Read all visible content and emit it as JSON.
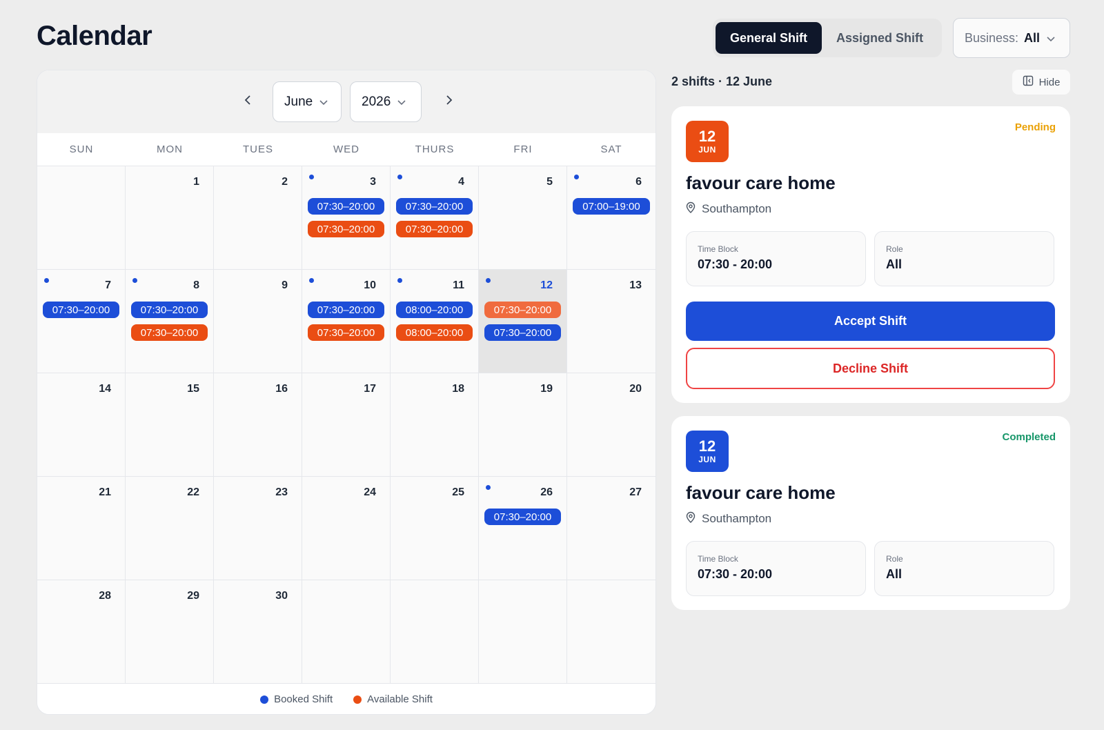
{
  "header": {
    "title": "Calendar"
  },
  "tabs": [
    {
      "label": "General Shift",
      "active": true
    },
    {
      "label": "Assigned Shift",
      "active": false
    }
  ],
  "business_filter": {
    "label": "Business:",
    "value": "All"
  },
  "calendar": {
    "month": "June",
    "year": "2026",
    "weekdays": [
      "SUN",
      "MON",
      "TUES",
      "WED",
      "THURS",
      "FRI",
      "SAT"
    ],
    "cells": [
      {
        "day": "",
        "dot": false,
        "selected": false,
        "shifts": []
      },
      {
        "day": "1",
        "dot": false,
        "selected": false,
        "shifts": []
      },
      {
        "day": "2",
        "dot": false,
        "selected": false,
        "shifts": []
      },
      {
        "day": "3",
        "dot": true,
        "selected": false,
        "shifts": [
          {
            "time": "07:30–20:00",
            "kind": "booked"
          },
          {
            "time": "07:30–20:00",
            "kind": "available"
          }
        ]
      },
      {
        "day": "4",
        "dot": true,
        "selected": false,
        "shifts": [
          {
            "time": "07:30–20:00",
            "kind": "booked"
          },
          {
            "time": "07:30–20:00",
            "kind": "available"
          }
        ]
      },
      {
        "day": "5",
        "dot": false,
        "selected": false,
        "shifts": []
      },
      {
        "day": "6",
        "dot": true,
        "selected": false,
        "shifts": [
          {
            "time": "07:00–19:00",
            "kind": "booked"
          }
        ]
      },
      {
        "day": "7",
        "dot": true,
        "selected": false,
        "shifts": [
          {
            "time": "07:30–20:00",
            "kind": "booked"
          }
        ]
      },
      {
        "day": "8",
        "dot": true,
        "selected": false,
        "shifts": [
          {
            "time": "07:30–20:00",
            "kind": "booked"
          },
          {
            "time": "07:30–20:00",
            "kind": "available"
          }
        ]
      },
      {
        "day": "9",
        "dot": false,
        "selected": false,
        "shifts": []
      },
      {
        "day": "10",
        "dot": true,
        "selected": false,
        "shifts": [
          {
            "time": "07:30–20:00",
            "kind": "booked"
          },
          {
            "time": "07:30–20:00",
            "kind": "available"
          }
        ]
      },
      {
        "day": "11",
        "dot": true,
        "selected": false,
        "shifts": [
          {
            "time": "08:00–20:00",
            "kind": "booked"
          },
          {
            "time": "08:00–20:00",
            "kind": "available"
          }
        ]
      },
      {
        "day": "12",
        "dot": true,
        "selected": true,
        "shifts": [
          {
            "time": "07:30–20:00",
            "kind": "available-light"
          },
          {
            "time": "07:30–20:00",
            "kind": "booked"
          }
        ]
      },
      {
        "day": "13",
        "dot": false,
        "selected": false,
        "shifts": []
      },
      {
        "day": "14",
        "dot": false,
        "selected": false,
        "shifts": []
      },
      {
        "day": "15",
        "dot": false,
        "selected": false,
        "shifts": []
      },
      {
        "day": "16",
        "dot": false,
        "selected": false,
        "shifts": []
      },
      {
        "day": "17",
        "dot": false,
        "selected": false,
        "shifts": []
      },
      {
        "day": "18",
        "dot": false,
        "selected": false,
        "shifts": []
      },
      {
        "day": "19",
        "dot": false,
        "selected": false,
        "shifts": []
      },
      {
        "day": "20",
        "dot": false,
        "selected": false,
        "shifts": []
      },
      {
        "day": "21",
        "dot": false,
        "selected": false,
        "shifts": []
      },
      {
        "day": "22",
        "dot": false,
        "selected": false,
        "shifts": []
      },
      {
        "day": "23",
        "dot": false,
        "selected": false,
        "shifts": []
      },
      {
        "day": "24",
        "dot": false,
        "selected": false,
        "shifts": []
      },
      {
        "day": "25",
        "dot": false,
        "selected": false,
        "shifts": []
      },
      {
        "day": "26",
        "dot": true,
        "selected": false,
        "shifts": [
          {
            "time": "07:30–20:00",
            "kind": "booked"
          }
        ]
      },
      {
        "day": "27",
        "dot": false,
        "selected": false,
        "shifts": []
      },
      {
        "day": "28",
        "dot": false,
        "selected": false,
        "shifts": []
      },
      {
        "day": "29",
        "dot": false,
        "selected": false,
        "shifts": []
      },
      {
        "day": "30",
        "dot": false,
        "selected": false,
        "shifts": []
      },
      {
        "day": "",
        "dot": false,
        "selected": false,
        "shifts": []
      },
      {
        "day": "",
        "dot": false,
        "selected": false,
        "shifts": []
      },
      {
        "day": "",
        "dot": false,
        "selected": false,
        "shifts": []
      },
      {
        "day": "",
        "dot": false,
        "selected": false,
        "shifts": []
      }
    ],
    "legend": [
      {
        "label": "Booked Shift",
        "color": "#1d4ed8"
      },
      {
        "label": "Available Shift",
        "color": "#ea4d13"
      }
    ]
  },
  "panel": {
    "summary": "2 shifts · 12 June",
    "hide_label": "Hide",
    "shifts": [
      {
        "day": "12",
        "month": "JUN",
        "status": "Pending",
        "place": "favour care home",
        "location": "Southampton",
        "time_block_label": "Time Block",
        "time_block": "07:30 - 20:00",
        "role_label": "Role",
        "role": "All",
        "accept_label": "Accept Shift",
        "decline_label": "Decline Shift"
      },
      {
        "day": "12",
        "month": "JUN",
        "status": "Completed",
        "place": "favour care home",
        "location": "Southampton",
        "time_block_label": "Time Block",
        "time_block": "07:30 - 20:00",
        "role_label": "Role",
        "role": "All"
      }
    ]
  },
  "colors": {
    "booked": "#1d4ed8",
    "available": "#ea4d13",
    "pending": "#eaa106",
    "completed": "#169669",
    "decline": "#dc2626"
  }
}
